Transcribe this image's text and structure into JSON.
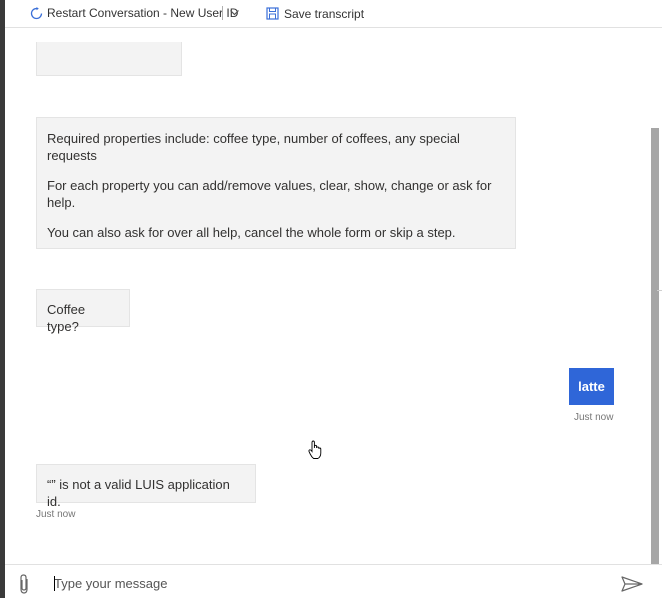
{
  "toolbar": {
    "restart_label": "Restart Conversation - New User ID",
    "save_label": "Save transcript"
  },
  "messages": {
    "bot_partial": {},
    "bot_info": {
      "line1": "Required properties include: coffee type, number of coffees, any special requests",
      "line2": "For each property you can add/remove values, clear, show, change or ask for help.",
      "line3": "You can also ask for over all help, cancel the whole form or skip a step."
    },
    "bot_question": {
      "text": "Coffee type?"
    },
    "user_reply": {
      "text": "latte",
      "timestamp": "Just now"
    },
    "bot_error": {
      "text": "“” is not a valid LUIS application id.",
      "timestamp": "Just now"
    }
  },
  "input": {
    "placeholder": "Type your message"
  },
  "colors": {
    "user_bubble": "#2f66d8",
    "bot_bubble": "#f3f3f3",
    "scrollbar": "#a6a6a6"
  },
  "icons": [
    "restart-icon",
    "chevron-down-icon",
    "save-icon",
    "attachment-icon",
    "send-icon",
    "hand-cursor-icon"
  ]
}
